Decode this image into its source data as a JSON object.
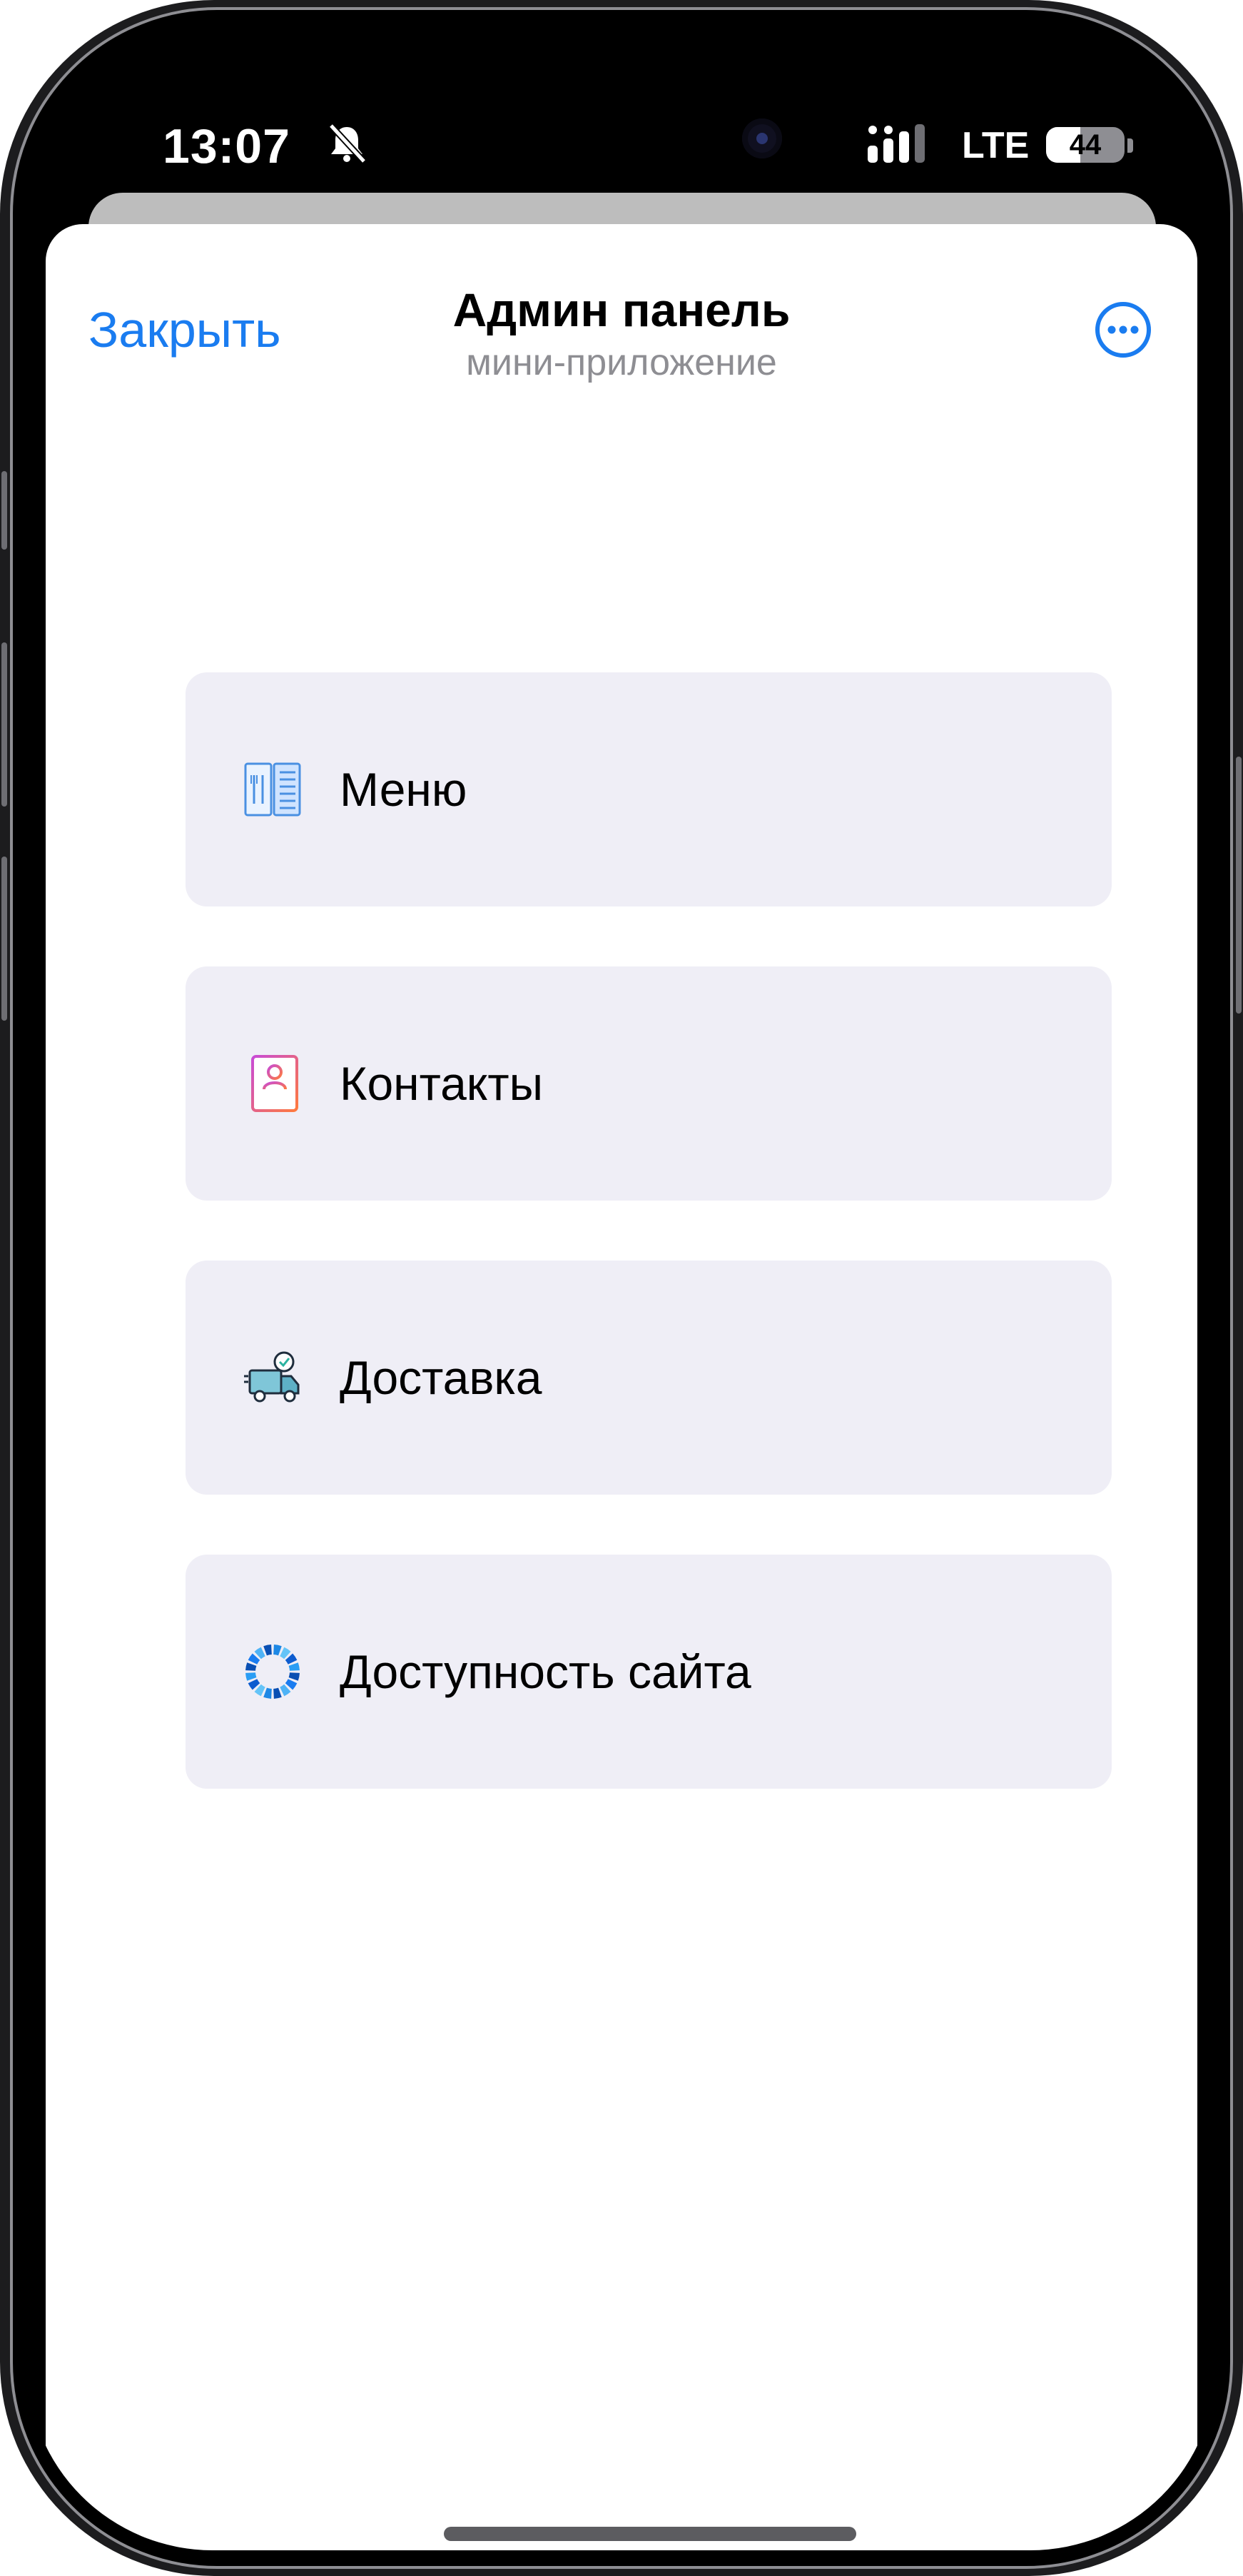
{
  "status_bar": {
    "time": "13:07",
    "bell_icon": "bell-slash-icon",
    "network": "LTE",
    "battery": "44",
    "battery_level_percent": 44
  },
  "header": {
    "close_label": "Закрыть",
    "title": "Админ панель",
    "subtitle": "мини-приложение",
    "more_icon": "ellipsis-circle-icon"
  },
  "menu": {
    "items": [
      {
        "label": "Меню",
        "icon": "restaurant-menu-icon"
      },
      {
        "label": "Контакты",
        "icon": "contacts-book-icon"
      },
      {
        "label": "Доставка",
        "icon": "delivery-truck-icon"
      },
      {
        "label": "Доступность сайта",
        "icon": "availability-ring-icon"
      }
    ]
  },
  "colors": {
    "accent": "#1a7cf0",
    "item_background": "#efeef6",
    "subtitle": "#8e8e93"
  }
}
